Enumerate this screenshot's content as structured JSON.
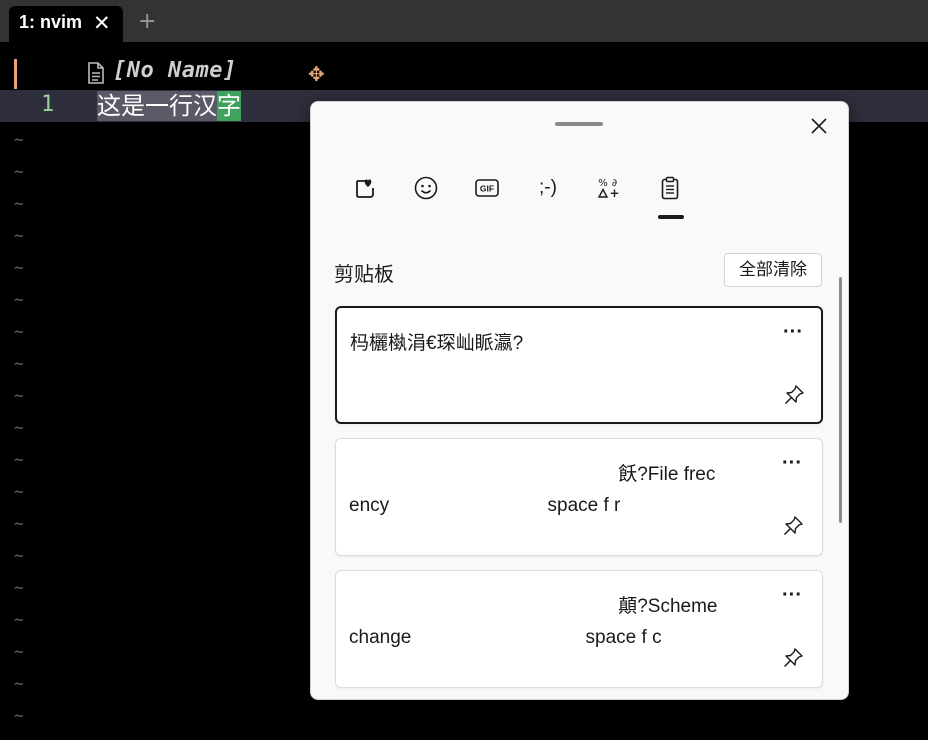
{
  "terminal": {
    "tab_title": "1: nvim",
    "tab_close_glyph": "✕",
    "new_tab_glyph": "+"
  },
  "nvim": {
    "winbar_filename": "[No Name]",
    "move_glyph": "✥",
    "line_number": "1",
    "line_text_selected": "这是一行汉",
    "line_text_cursor": "字",
    "tilde": "~"
  },
  "clipboard": {
    "categories": [
      {
        "name": "kaomoji-favorites",
        "icon": "heart-sticker-icon"
      },
      {
        "name": "emoji",
        "icon": "smiley-icon"
      },
      {
        "name": "gif",
        "icon": "gif-icon",
        "label": "GIF"
      },
      {
        "name": "kaomoji",
        "label": ";-)"
      },
      {
        "name": "symbols",
        "icon": "symbols-icon"
      },
      {
        "name": "clipboard-history",
        "icon": "clipboard-icon",
        "active": true
      }
    ],
    "section_title": "剪贴板",
    "clear_all_label": "全部清除",
    "more_glyph": "···",
    "items": [
      {
        "text": "杩欐槸涓€琛屾眽瀛?",
        "selected": true
      },
      {
        "text": "                                                   飫?File frec\nency                              space f r",
        "selected": false
      },
      {
        "text": "                                                   顛?Scheme\nchange                                 space f c",
        "selected": false
      }
    ]
  },
  "colors": {
    "terminal_bg": "#000000",
    "tabbar_bg": "#333333",
    "cursorline_bg": "#2e2e3c",
    "cursor_char_bg": "#3fa35d",
    "line_number": "#9bd29b",
    "panel_bg": "#f9f9f9"
  }
}
